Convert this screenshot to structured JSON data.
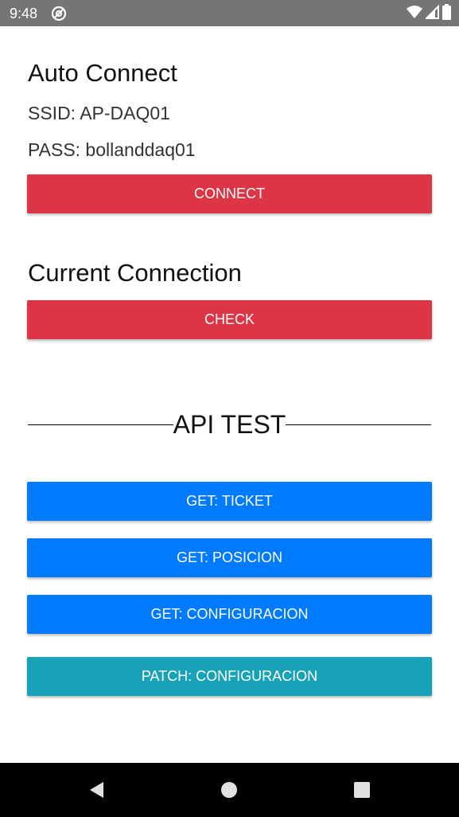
{
  "status_bar": {
    "time": "9:48",
    "icons": [
      "at-sign-icon",
      "wifi-icon",
      "signal-icon",
      "battery-icon"
    ]
  },
  "auto_connect": {
    "title": "Auto Connect",
    "ssid": "SSID: AP-DAQ01",
    "pass": "PASS: bollanddaq01",
    "connect_label": "CONNECT"
  },
  "current_connection": {
    "title": "Current Connection",
    "check_label": "CHECK"
  },
  "api_test": {
    "title": "API TEST",
    "buttons": [
      {
        "label": "GET: TICKET"
      },
      {
        "label": "GET: POSICION"
      },
      {
        "label": "GET: CONFIGURACION"
      },
      {
        "label": "PATCH: CONFIGURACION"
      }
    ]
  },
  "nav_bar": {
    "icons": [
      "back-icon",
      "home-icon",
      "recents-icon"
    ]
  },
  "colors": {
    "danger": "#dc3545",
    "primary": "#007bff",
    "info": "#17a2b8",
    "status_bar": "#757575",
    "nav_bar": "#000000"
  }
}
